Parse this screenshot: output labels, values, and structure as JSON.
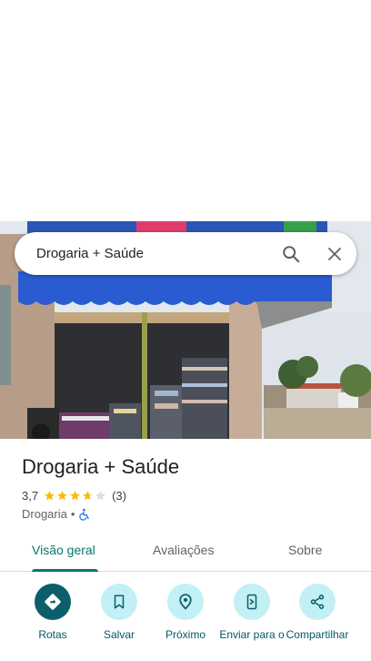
{
  "search": {
    "query": "Drogaria + Saúde"
  },
  "place": {
    "title": "Drogaria + Saúde",
    "rating": "3,7",
    "rating_value": 3.7,
    "review_count": "(3)",
    "category": "Drogaria",
    "separator": "•"
  },
  "tabs": [
    {
      "label": "Visão geral",
      "active": true
    },
    {
      "label": "Avaliações",
      "active": false
    },
    {
      "label": "Sobre",
      "active": false
    }
  ],
  "actions": [
    {
      "label": "Rotas",
      "icon": "directions-icon"
    },
    {
      "label": "Salvar",
      "icon": "bookmark-icon"
    },
    {
      "label": "Próximo",
      "icon": "nearby-icon"
    },
    {
      "label": "Enviar para o",
      "icon": "send-to-phone-icon"
    },
    {
      "label": "Compartilhar",
      "icon": "share-icon"
    }
  ],
  "colors": {
    "accent": "#00796b",
    "action_bg": "#c2f0f5",
    "action_primary": "#0b5f6a",
    "star": "#fbbc04",
    "awning": "#2a5bd0"
  }
}
